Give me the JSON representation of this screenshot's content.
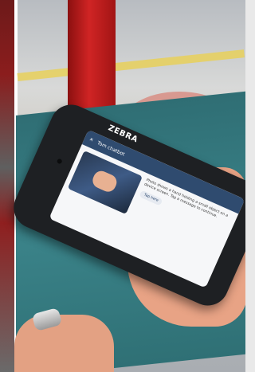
{
  "device": {
    "brand_text": "ZEBRA"
  },
  "app_screen": {
    "title": "Tom chatbot",
    "body_text": "Photo shows a hand holding a small object on a device screen. Tap a message to continue.",
    "button_label": "Tap here"
  }
}
